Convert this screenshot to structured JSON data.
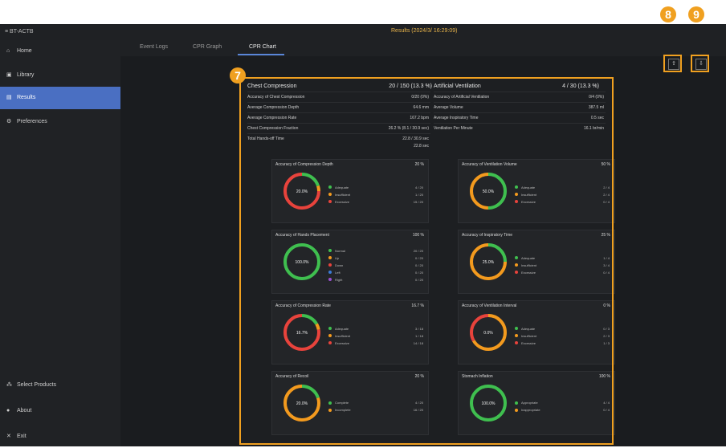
{
  "titlebar": {
    "app_name": "BT-ACTB",
    "results_label": "Results  (2024/3/  16:29:09)"
  },
  "sidebar": {
    "items": [
      {
        "label": "Home",
        "icon": "home-icon",
        "glyph": "⌂"
      },
      {
        "label": "Library",
        "icon": "library-icon",
        "glyph": "▣"
      },
      {
        "label": "Results",
        "icon": "results-icon",
        "glyph": "▤"
      },
      {
        "label": "Preferences",
        "icon": "gear-icon",
        "glyph": "⚙"
      }
    ],
    "bottom": [
      {
        "label": "Select Products",
        "icon": "products-icon",
        "glyph": "⁂"
      },
      {
        "label": "About",
        "icon": "info-icon",
        "glyph": "●"
      },
      {
        "label": "Exit",
        "icon": "close-icon",
        "glyph": "✕"
      }
    ]
  },
  "tabs": [
    "Event Logs",
    "CPR Graph",
    "CPR Chart"
  ],
  "annotations": {
    "a7": "7",
    "a8": "8",
    "a9": "9"
  },
  "compression": {
    "title": "Chest Compression",
    "value": "20 / 150 (13.3 %)",
    "rows": [
      {
        "label": "Accuracy of Chest Compression",
        "value": "0/20 (0%)"
      },
      {
        "label": "Average Compression Depth",
        "value": "64.6 mm"
      },
      {
        "label": "Average Compression Rate",
        "value": "167.2 bpm"
      },
      {
        "label": "Chest Compression Fraction",
        "value": "26.2 % (8.1 / 30.9 sec)"
      },
      {
        "label": "Total Hands-off Time",
        "value": "22.8 / 30.9 sec"
      }
    ],
    "extra": "22.8 sec"
  },
  "ventilation": {
    "title": "Artificial Ventilation",
    "value": "4 / 30 (13.3 %)",
    "rows": [
      {
        "label": "Accuracy of Artificial Ventilation",
        "value": "0/4 (0%)"
      },
      {
        "label": "Average Volume",
        "value": "387.5 ml"
      },
      {
        "label": "Average Inspiratory Time",
        "value": "0.5 sec"
      },
      {
        "label": "Ventilation Per Minute",
        "value": "16.1 br/min"
      }
    ]
  },
  "colors": {
    "green": "#3fbf4f",
    "orange": "#f39a1e",
    "red": "#e8433c",
    "blue": "#3a7bd5",
    "purple": "#9a4fd0"
  },
  "cards": [
    {
      "title": "Accuracy of Compression Depth",
      "value": "20 %",
      "center": "20.0%",
      "legend": [
        {
          "label": "Adequate",
          "value": "4 / 20",
          "color": "#3fbf4f"
        },
        {
          "label": "Insufficient",
          "value": "1 / 20",
          "color": "#f39a1e"
        },
        {
          "label": "Excessive",
          "value": "15 / 20",
          "color": "#e8433c"
        }
      ],
      "segments": [
        {
          "frac": 0.2,
          "color": "#3fbf4f"
        },
        {
          "frac": 0.05,
          "color": "#f39a1e"
        },
        {
          "frac": 0.75,
          "color": "#e8433c"
        }
      ]
    },
    {
      "title": "Accuracy of Ventilation Volume",
      "value": "50 %",
      "center": "50.0%",
      "legend": [
        {
          "label": "Adequate",
          "value": "2 / 4",
          "color": "#3fbf4f"
        },
        {
          "label": "Insufficient",
          "value": "2 / 4",
          "color": "#f39a1e"
        },
        {
          "label": "Excessive",
          "value": "0 / 4",
          "color": "#e8433c"
        }
      ],
      "segments": [
        {
          "frac": 0.5,
          "color": "#3fbf4f"
        },
        {
          "frac": 0.5,
          "color": "#f39a1e"
        }
      ]
    },
    {
      "title": "Accuracy of Hands Placement",
      "value": "100 %",
      "center": "100.0%",
      "legend": [
        {
          "label": "Normal",
          "value": "20 / 20",
          "color": "#3fbf4f"
        },
        {
          "label": "Up",
          "value": "0 / 20",
          "color": "#f39a1e"
        },
        {
          "label": "Down",
          "value": "0 / 20",
          "color": "#e8433c"
        },
        {
          "label": "Left",
          "value": "0 / 20",
          "color": "#3a7bd5"
        },
        {
          "label": "Right",
          "value": "0 / 20",
          "color": "#9a4fd0"
        }
      ],
      "segments": [
        {
          "frac": 1,
          "color": "#3fbf4f"
        }
      ]
    },
    {
      "title": "Accuracy of Inspiratory Time",
      "value": "25 %",
      "center": "25.0%",
      "legend": [
        {
          "label": "Adequate",
          "value": "1 / 4",
          "color": "#3fbf4f"
        },
        {
          "label": "Insufficient",
          "value": "3 / 4",
          "color": "#f39a1e"
        },
        {
          "label": "Excessive",
          "value": "0 / 4",
          "color": "#e8433c"
        }
      ],
      "segments": [
        {
          "frac": 0.25,
          "color": "#3fbf4f"
        },
        {
          "frac": 0.75,
          "color": "#f39a1e"
        }
      ]
    },
    {
      "title": "Accuracy of Compression Rate",
      "value": "16.7 %",
      "center": "16.7%",
      "legend": [
        {
          "label": "Adequate",
          "value": "3 / 18",
          "color": "#3fbf4f"
        },
        {
          "label": "Insufficient",
          "value": "1 / 18",
          "color": "#f39a1e"
        },
        {
          "label": "Excessive",
          "value": "14 / 18",
          "color": "#e8433c"
        }
      ],
      "segments": [
        {
          "frac": 0.167,
          "color": "#3fbf4f"
        },
        {
          "frac": 0.056,
          "color": "#f39a1e"
        },
        {
          "frac": 0.777,
          "color": "#e8433c"
        }
      ]
    },
    {
      "title": "Accuracy of Ventilation Interval",
      "value": "0 %",
      "center": "0.0%",
      "legend": [
        {
          "label": "Adequate",
          "value": "0 / 3",
          "color": "#3fbf4f"
        },
        {
          "label": "Insufficient",
          "value": "2 / 3",
          "color": "#f39a1e"
        },
        {
          "label": "Excessive",
          "value": "1 / 3",
          "color": "#e8433c"
        }
      ],
      "segments": [
        {
          "frac": 0.667,
          "color": "#f39a1e"
        },
        {
          "frac": 0.333,
          "color": "#e8433c"
        }
      ]
    },
    {
      "title": "Accuracy of Recoil",
      "value": "20 %",
      "center": "20.0%",
      "legend": [
        {
          "label": "Complete",
          "value": "4 / 20",
          "color": "#3fbf4f"
        },
        {
          "label": "Incomplete",
          "value": "16 / 20",
          "color": "#f39a1e"
        }
      ],
      "segments": [
        {
          "frac": 0.2,
          "color": "#3fbf4f"
        },
        {
          "frac": 0.8,
          "color": "#f39a1e"
        }
      ]
    },
    {
      "title": "Stomach Inflation",
      "value": "100 %",
      "center": "100.0%",
      "legend": [
        {
          "label": "Appropriate",
          "value": "4 / 4",
          "color": "#3fbf4f"
        },
        {
          "label": "Inappropriate",
          "value": "0 / 4",
          "color": "#f39a1e"
        }
      ],
      "segments": [
        {
          "frac": 1,
          "color": "#3fbf4f"
        }
      ]
    }
  ]
}
